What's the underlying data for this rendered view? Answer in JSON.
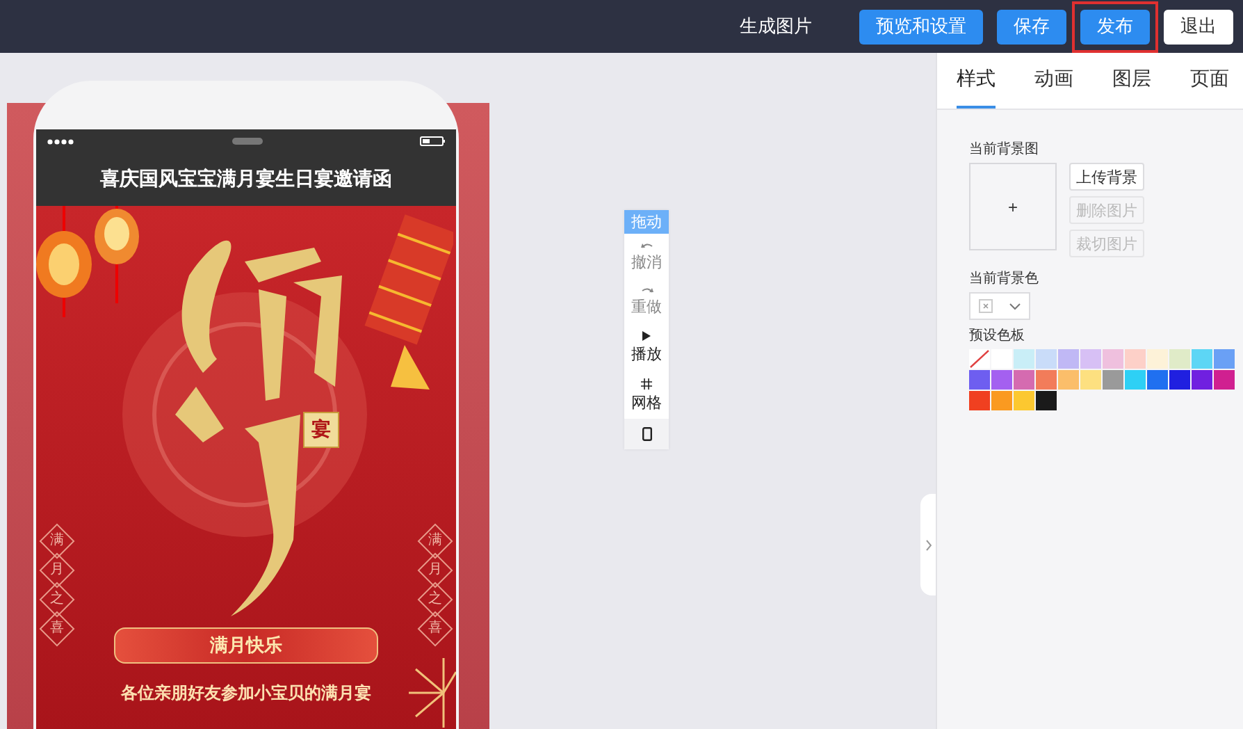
{
  "topbar": {
    "actions": [
      {
        "label": "生成图片",
        "kind": "text",
        "highlighted": false
      },
      {
        "label": "预览和设置",
        "kind": "primary",
        "highlighted": false
      },
      {
        "label": "保存",
        "kind": "primary",
        "highlighted": false
      },
      {
        "label": "发布",
        "kind": "primary",
        "highlighted": true
      },
      {
        "label": "退出",
        "kind": "plain",
        "highlighted": false
      }
    ]
  },
  "phone": {
    "title": "喜庆国风宝宝满月宴生日宴邀请函",
    "poster": {
      "seal": "宴",
      "side_text_left": [
        "满",
        "月",
        "之",
        "喜"
      ],
      "side_text_right": [
        "满",
        "月",
        "之",
        "喜"
      ],
      "banner": "满月快乐",
      "subtitle": "各位亲朋好友参加小宝贝的满月宴"
    }
  },
  "toolbar": {
    "handle": "拖动",
    "tools": [
      {
        "kind": "undo",
        "label": "撤消",
        "disabled": true
      },
      {
        "kind": "redo",
        "label": "重做",
        "disabled": true
      },
      {
        "kind": "play",
        "label": "播放",
        "disabled": false
      },
      {
        "kind": "grid",
        "label": "网格",
        "disabled": false
      },
      {
        "kind": "device"
      }
    ]
  },
  "panel": {
    "tabs": [
      {
        "label": "样式",
        "selected": true
      },
      {
        "label": "动画",
        "selected": false
      },
      {
        "label": "图层",
        "selected": false
      },
      {
        "label": "页面",
        "selected": false
      }
    ],
    "background_image": {
      "label": "当前背景图",
      "add": "+",
      "buttons": [
        {
          "label": "上传背景",
          "disabled": false
        },
        {
          "label": "删除图片",
          "disabled": true
        },
        {
          "label": "裁切图片",
          "disabled": true
        }
      ]
    },
    "background_color": {
      "label": "当前背景色"
    },
    "palette": {
      "label": "预设色板",
      "swatches": [
        {
          "kind": "none"
        },
        {
          "kind": "solid",
          "color": "#ffffff"
        },
        {
          "kind": "solid",
          "color": "#c9eef7"
        },
        {
          "kind": "solid",
          "color": "#c9dcf9"
        },
        {
          "kind": "solid",
          "color": "#c0b8f5"
        },
        {
          "kind": "solid",
          "color": "#d7c0f5"
        },
        {
          "kind": "solid",
          "color": "#efc0de"
        },
        {
          "kind": "solid",
          "color": "#fdd0c8"
        },
        {
          "kind": "solid",
          "color": "#fdf2d8"
        },
        {
          "kind": "solid",
          "color": "#e0ebc8"
        },
        {
          "kind": "solid",
          "color": "#5dd6f5"
        },
        {
          "kind": "solid",
          "color": "#6aa0f5"
        },
        {
          "kind": "solid",
          "color": "#6e5ef0"
        },
        {
          "kind": "solid",
          "color": "#a460f0"
        },
        {
          "kind": "solid",
          "color": "#d56bb0"
        },
        {
          "kind": "solid",
          "color": "#f27c5a"
        },
        {
          "kind": "solid",
          "color": "#fbbe6a"
        },
        {
          "kind": "solid",
          "color": "#fde080"
        },
        {
          "kind": "solid",
          "color": "#9a9a9a"
        },
        {
          "kind": "solid",
          "color": "#2ed0f5"
        },
        {
          "kind": "solid",
          "color": "#2070f0"
        },
        {
          "kind": "solid",
          "color": "#2020e0"
        },
        {
          "kind": "solid",
          "color": "#7020e0"
        },
        {
          "kind": "solid",
          "color": "#d02090"
        },
        {
          "kind": "solid",
          "color": "#f04020"
        },
        {
          "kind": "solid",
          "color": "#fa9a20"
        },
        {
          "kind": "solid",
          "color": "#fcc830"
        },
        {
          "kind": "solid",
          "color": "#1a1a1a"
        }
      ]
    }
  }
}
